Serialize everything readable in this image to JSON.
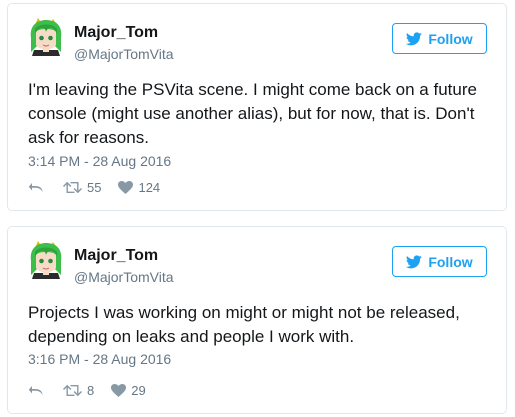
{
  "tweets": [
    {
      "display_name": "Major_Tom",
      "username": "@MajorTomVita",
      "follow_label": "Follow",
      "text": "I'm leaving the PSVita scene. I might come back on a future console (might use another alias), but for now, that is. Don't ask for reasons.",
      "timestamp": "3:14 PM - 28 Aug 2016",
      "retweets": "55",
      "likes": "124"
    },
    {
      "display_name": "Major_Tom",
      "username": "@MajorTomVita",
      "follow_label": "Follow",
      "text": "Projects I was working on might or might not be released, depending on leaks and people I work with.",
      "timestamp": "3:16 PM - 28 Aug 2016",
      "retweets": "8",
      "likes": "29"
    }
  ],
  "icons": {
    "avatar": "avatar-green-hair-anime-character",
    "follow": "twitter-bird-icon",
    "reply": "reply-icon",
    "retweet": "retweet-icon",
    "like": "heart-icon"
  },
  "colors": {
    "accent": "#1da1f2",
    "muted": "#657786",
    "icon": "#8899a6",
    "border": "#e1e8ed"
  }
}
